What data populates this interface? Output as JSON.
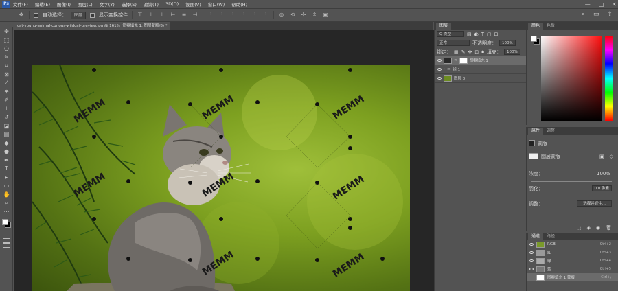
{
  "menu": {
    "logo": "Ps",
    "items": [
      "文件(F)",
      "编辑(E)",
      "图像(I)",
      "图层(L)",
      "文字(Y)",
      "选择(S)",
      "滤镜(T)",
      "3D(D)",
      "视图(V)",
      "窗口(W)",
      "帮助(H)"
    ],
    "window_controls": [
      "—",
      "□",
      "✕"
    ]
  },
  "options": {
    "auto_select_label": "自动选择：",
    "auto_select_value": "图层",
    "transform_label": "显示变换控件"
  },
  "document": {
    "tab_title": "cat-young-animal-curious-wildcat-preview.jpg @ 161% (图案填充 1, 图层蒙版/8) *",
    "watermark": "MEMM"
  },
  "layers_panel": {
    "tabs": [
      "图层"
    ],
    "filter_label": "Q 类型",
    "blend_mode": "正常",
    "opacity_label": "不透明度：",
    "opacity_value": "100%",
    "lock_label": "锁定：",
    "fill_label": "填充：",
    "fill_value": "100%",
    "layers": [
      {
        "name": "图案填充 1",
        "selected": true
      },
      {
        "name": "组 1",
        "selected": false
      },
      {
        "name": "图层 0",
        "selected": false
      }
    ]
  },
  "color_panel": {
    "tabs": [
      "颜色",
      "色板"
    ]
  },
  "properties_panel": {
    "tabs": [
      "属性",
      "调整"
    ],
    "mask_label": "蒙版",
    "layer_mask_label": "图层蒙版",
    "density_label": "浓度：",
    "density_value": "100%",
    "feather_label": "羽化：",
    "feather_value": "0.0 像素",
    "refine_label": "调整：",
    "select_mask_button": "选择并遮住..."
  },
  "channels_panel": {
    "tabs": [
      "通道",
      "路径"
    ],
    "channels": [
      {
        "name": "RGB",
        "shortcut": "Ctrl+2"
      },
      {
        "name": "红",
        "shortcut": "Ctrl+3"
      },
      {
        "name": "绿",
        "shortcut": "Ctrl+4"
      },
      {
        "name": "蓝",
        "shortcut": "Ctrl+5"
      },
      {
        "name": "图案填充 1 蒙版",
        "shortcut": "Ctrl+\\"
      }
    ]
  },
  "colors": {
    "ui_bg": "#535353",
    "canvas_bg": "#262626",
    "accent": "#2b5aa8"
  }
}
